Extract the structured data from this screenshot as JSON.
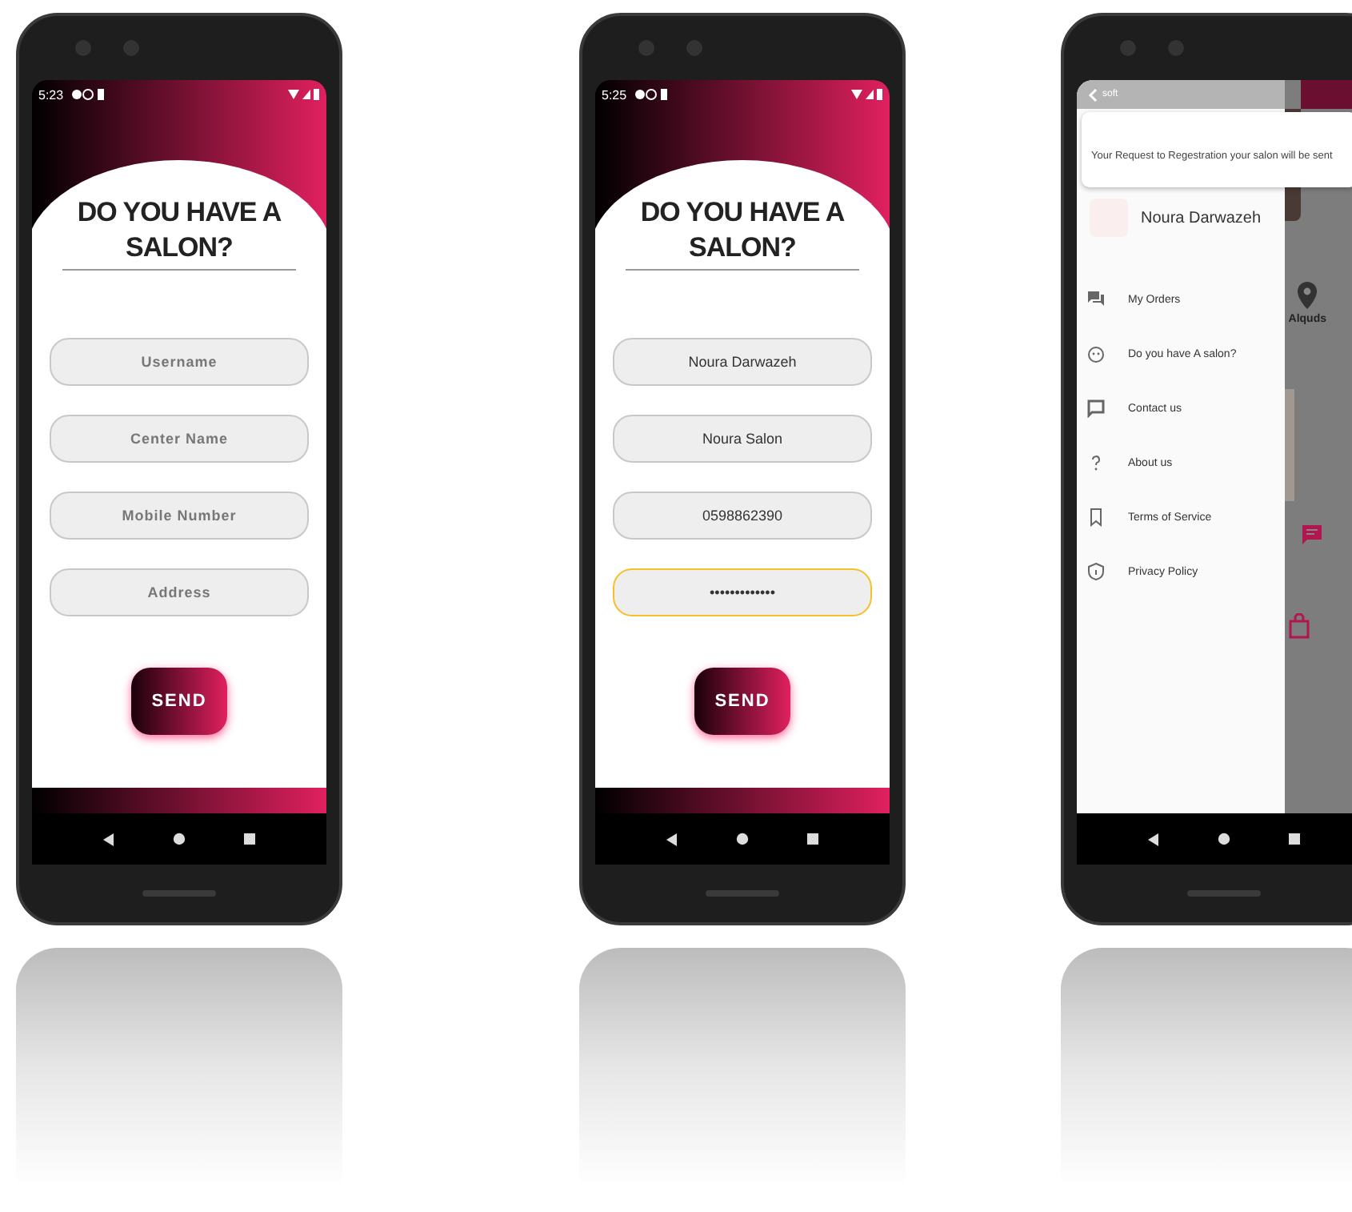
{
  "phones": [
    {
      "kind": "form",
      "status_time": "5:23",
      "title": "DO YOU HAVE A SALON?",
      "fields": [
        {
          "placeholder": "Username",
          "focused": false
        },
        {
          "placeholder": "Center Name",
          "focused": false
        },
        {
          "placeholder": "Mobile Number",
          "focused": false
        },
        {
          "placeholder": "Address",
          "focused": false
        }
      ],
      "button": "SEND"
    },
    {
      "kind": "form",
      "status_time": "5:25",
      "title": "DO YOU HAVE A SALON?",
      "fields": [
        {
          "value": "Noura Darwazeh",
          "focused": false
        },
        {
          "value": "Noura Salon",
          "focused": false
        },
        {
          "value": "0598862390",
          "focused": false
        },
        {
          "value": "•••••••••••••",
          "focused": true
        }
      ],
      "button": "SEND"
    },
    {
      "kind": "drawer",
      "back_label": "soft",
      "toast": "Your Request to Regestration your salon will be sent",
      "profile_name": "Noura Darwazeh",
      "menu": [
        {
          "label": "My Orders",
          "kind": "chat"
        },
        {
          "label": "Do you have A salon?",
          "kind": "face"
        },
        {
          "label": "Contact us",
          "kind": "message"
        },
        {
          "label": "About us",
          "kind": "question"
        },
        {
          "label": "Terms of Service",
          "kind": "bookmark"
        },
        {
          "label": "Privacy Policy",
          "kind": "shield"
        }
      ],
      "location_label": "Alquds"
    }
  ]
}
